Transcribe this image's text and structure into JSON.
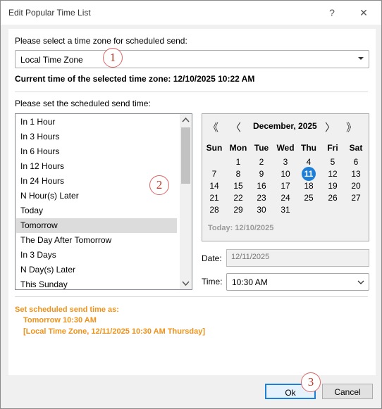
{
  "window": {
    "title": "Edit Popular Time List",
    "help_icon": "?",
    "close_icon": "✕"
  },
  "timezone": {
    "prompt": "Please select a time zone for scheduled send:",
    "selected": "Local Time Zone",
    "current_time_label": "Current time of the selected time zone: 12/10/2025 10:22 AM"
  },
  "schedule": {
    "prompt": "Please set the scheduled send time:",
    "items": [
      "In 1 Hour",
      "In 3 Hours",
      "In 6 Hours",
      "In 12 Hours",
      "In 24 Hours",
      "N Hour(s) Later",
      "Today",
      "Tomorrow",
      "The Day After Tomorrow",
      "In 3 Days",
      "N Day(s) Later",
      "This Sunday"
    ],
    "selected_index": 7
  },
  "calendar": {
    "prev_year": "《",
    "prev_month": "〈",
    "next_month": "〉",
    "next_year": "》",
    "month_label": "December, 2025",
    "weekdays": [
      "Sun",
      "Mon",
      "Tue",
      "Wed",
      "Thu",
      "Fri",
      "Sat"
    ],
    "weeks": [
      [
        "",
        "1",
        "2",
        "3",
        "4",
        "5",
        "6"
      ],
      [
        "7",
        "8",
        "9",
        "10",
        "11",
        "12",
        "13"
      ],
      [
        "14",
        "15",
        "16",
        "17",
        "18",
        "19",
        "20"
      ],
      [
        "21",
        "22",
        "23",
        "24",
        "25",
        "26",
        "27"
      ],
      [
        "28",
        "29",
        "30",
        "31",
        "",
        "",
        ""
      ]
    ],
    "highlighted_day": "11",
    "today_label": "Today: 12/10/2025",
    "highlight_color": "#1e7fd6"
  },
  "fields": {
    "date_label": "Date:",
    "date_value": "12/11/2025",
    "time_label": "Time:",
    "time_value": "10:30 AM"
  },
  "summary": {
    "line1": "Set scheduled send time as:",
    "line2": "Tomorrow 10:30 AM",
    "line3": "[Local Time Zone, 12/11/2025 10:30 AM Thursday]",
    "color": "#f0921a"
  },
  "buttons": {
    "ok": "Ok",
    "cancel": "Cancel"
  },
  "markers": [
    "1",
    "2",
    "3"
  ]
}
